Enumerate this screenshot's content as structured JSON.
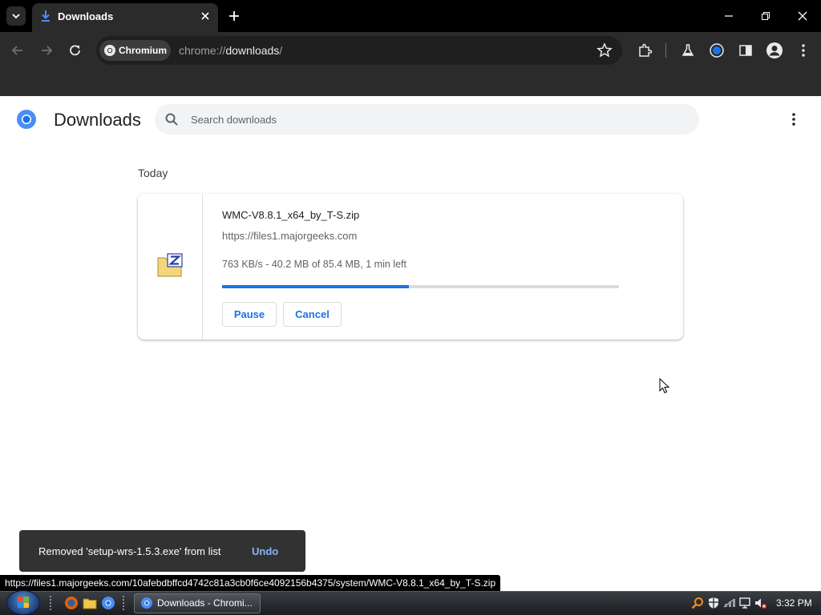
{
  "browser": {
    "tab_title": "Downloads",
    "chip_label": "Chromium",
    "url_scheme": "chrome://",
    "url_host": "downloads",
    "url_path": "/"
  },
  "page": {
    "title": "Downloads",
    "search_placeholder": "Search downloads",
    "section_label": "Today"
  },
  "download": {
    "file_name": "WMC-V8.8.1_x64_by_T-S.zip",
    "source_url": "https://files1.majorgeeks.com",
    "status": "763 KB/s - 40.2 MB of 85.4 MB, 1 min left",
    "progress_fraction": 0.47,
    "pause_label": "Pause",
    "cancel_label": "Cancel"
  },
  "toast": {
    "message": "Removed 'setup-wrs-1.5.3.exe' from list",
    "action_label": "Undo"
  },
  "status_bar_url": "https://files1.majorgeeks.com/10afebdbffcd4742c81a3cb0f6ce4092156b4375/system/WMC-V8.8.1_x64_by_T-S.zip",
  "taskbar": {
    "window_label": "Downloads - Chromi...",
    "clock": "3:32 PM"
  },
  "colors": {
    "accent": "#1a73e8",
    "chrome_dark": "#2b2b2b",
    "toast_bg": "#323232"
  }
}
